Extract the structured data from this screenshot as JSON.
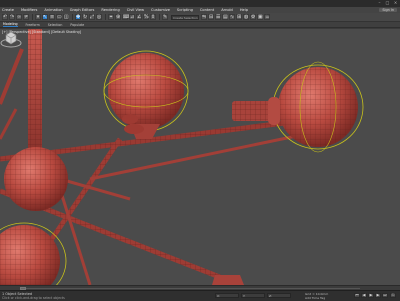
{
  "menu": {
    "items": [
      "Create",
      "Modifiers",
      "Animation",
      "Graph Editors",
      "Rendering",
      "Civil View",
      "Customize",
      "Scripting",
      "Content",
      "Arnold",
      "Help"
    ],
    "signin_label": "Sign In"
  },
  "toolbar": {
    "selection_set_placeholder": "Create Selection Set"
  },
  "ribbon": {
    "tabs": [
      "Modeling",
      "Freeform",
      "Selection",
      "Populate"
    ]
  },
  "viewport": {
    "label": "[+] [Perspective] [Standard] [Default Shading]"
  },
  "status": {
    "text": "1 Object Selected",
    "prompt": "Click or click-and-drag to select objects",
    "grid": "Grid = 10.0mm",
    "coord_x": "X:",
    "coord_y": "Y:",
    "coord_z": "Z:",
    "add_time_tag": "Add Time Tag"
  },
  "colors": {
    "object_red": "#b5473f",
    "object_highlight": "#d86a5f",
    "gizmo_yellow": "#c9c21b",
    "viewport_bg": "#4a4a4a",
    "accent_blue": "#2f7ec7"
  },
  "icons": [
    "undo-icon",
    "redo-icon",
    "link-icon",
    "unlink-icon",
    "select-icon",
    "move-icon",
    "rotate-icon",
    "scale-icon",
    "snap-icon",
    "mirror-icon",
    "align-icon",
    "render-icon",
    "viewcube-icon",
    "play-icon"
  ]
}
